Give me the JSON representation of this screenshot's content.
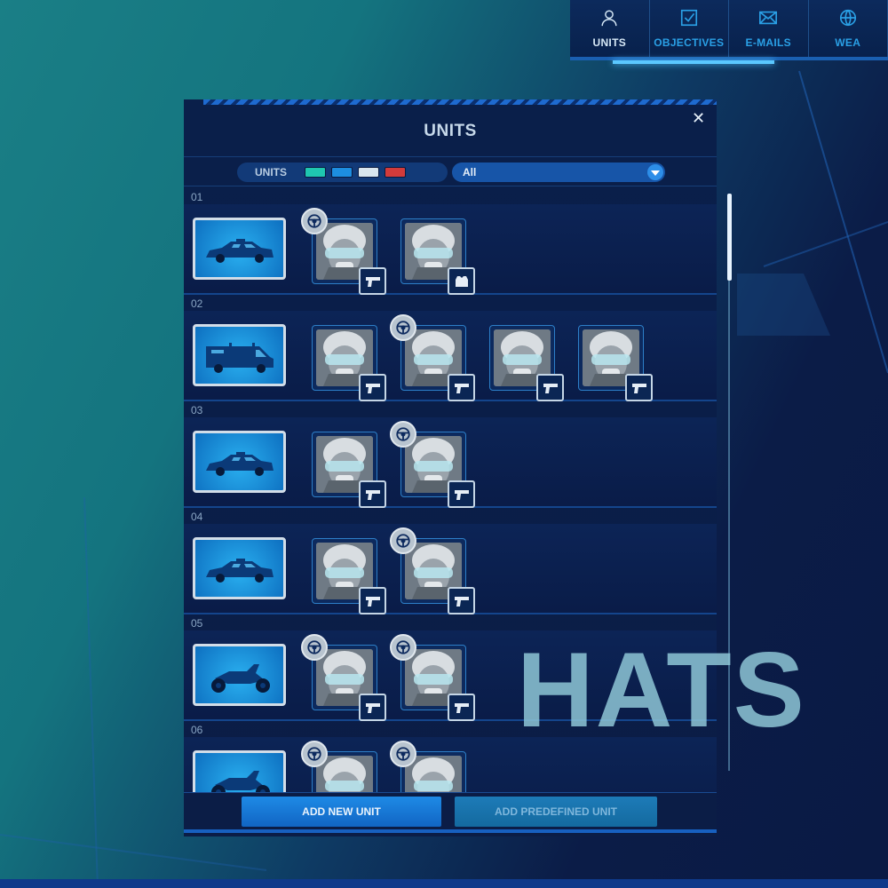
{
  "nav": {
    "tabs": [
      {
        "label": "UNITS",
        "icon": "person-icon",
        "active": true
      },
      {
        "label": "OBJECTIVES",
        "icon": "checkbox-icon",
        "active": false
      },
      {
        "label": "E-MAILS",
        "icon": "envelope-icon",
        "active": false
      },
      {
        "label": "WEA",
        "icon": "globe-icon",
        "active": false
      }
    ]
  },
  "panel": {
    "title": "UNITS",
    "close_icon": "close-icon",
    "filter": {
      "units_label": "UNITS",
      "swatches": [
        "#1fc7b0",
        "#1d8ee0",
        "#d9e6ee",
        "#d23b3b"
      ],
      "dropdown_value": "All"
    },
    "rows": [
      {
        "number": "01",
        "vehicle": "police-car",
        "crew": [
          {
            "driver": true,
            "weapon": "pistol-icon"
          },
          {
            "driver": false,
            "weapon": "vest-icon"
          }
        ]
      },
      {
        "number": "02",
        "vehicle": "police-van",
        "crew": [
          {
            "driver": false,
            "weapon": "pistol-icon"
          },
          {
            "driver": true,
            "weapon": "pistol-icon"
          },
          {
            "driver": false,
            "weapon": "pistol-icon"
          },
          {
            "driver": false,
            "weapon": "pistol-icon"
          }
        ]
      },
      {
        "number": "03",
        "vehicle": "police-car",
        "crew": [
          {
            "driver": false,
            "weapon": "pistol-icon"
          },
          {
            "driver": true,
            "weapon": "pistol-icon"
          }
        ]
      },
      {
        "number": "04",
        "vehicle": "police-car",
        "crew": [
          {
            "driver": false,
            "weapon": "pistol-icon"
          },
          {
            "driver": true,
            "weapon": "pistol-icon"
          }
        ]
      },
      {
        "number": "05",
        "vehicle": "police-motorcycle",
        "crew": [
          {
            "driver": true,
            "weapon": "pistol-icon"
          },
          {
            "driver": true,
            "weapon": "pistol-icon"
          }
        ]
      },
      {
        "number": "06",
        "vehicle": "police-motorcycle",
        "crew": [
          {
            "driver": true,
            "weapon": "pistol-icon"
          },
          {
            "driver": true,
            "weapon": "pistol-icon"
          }
        ]
      }
    ],
    "buttons": {
      "add_new": "ADD NEW UNIT",
      "add_predefined": "ADD PREDEFINED UNIT"
    }
  },
  "watermark": "HATS"
}
